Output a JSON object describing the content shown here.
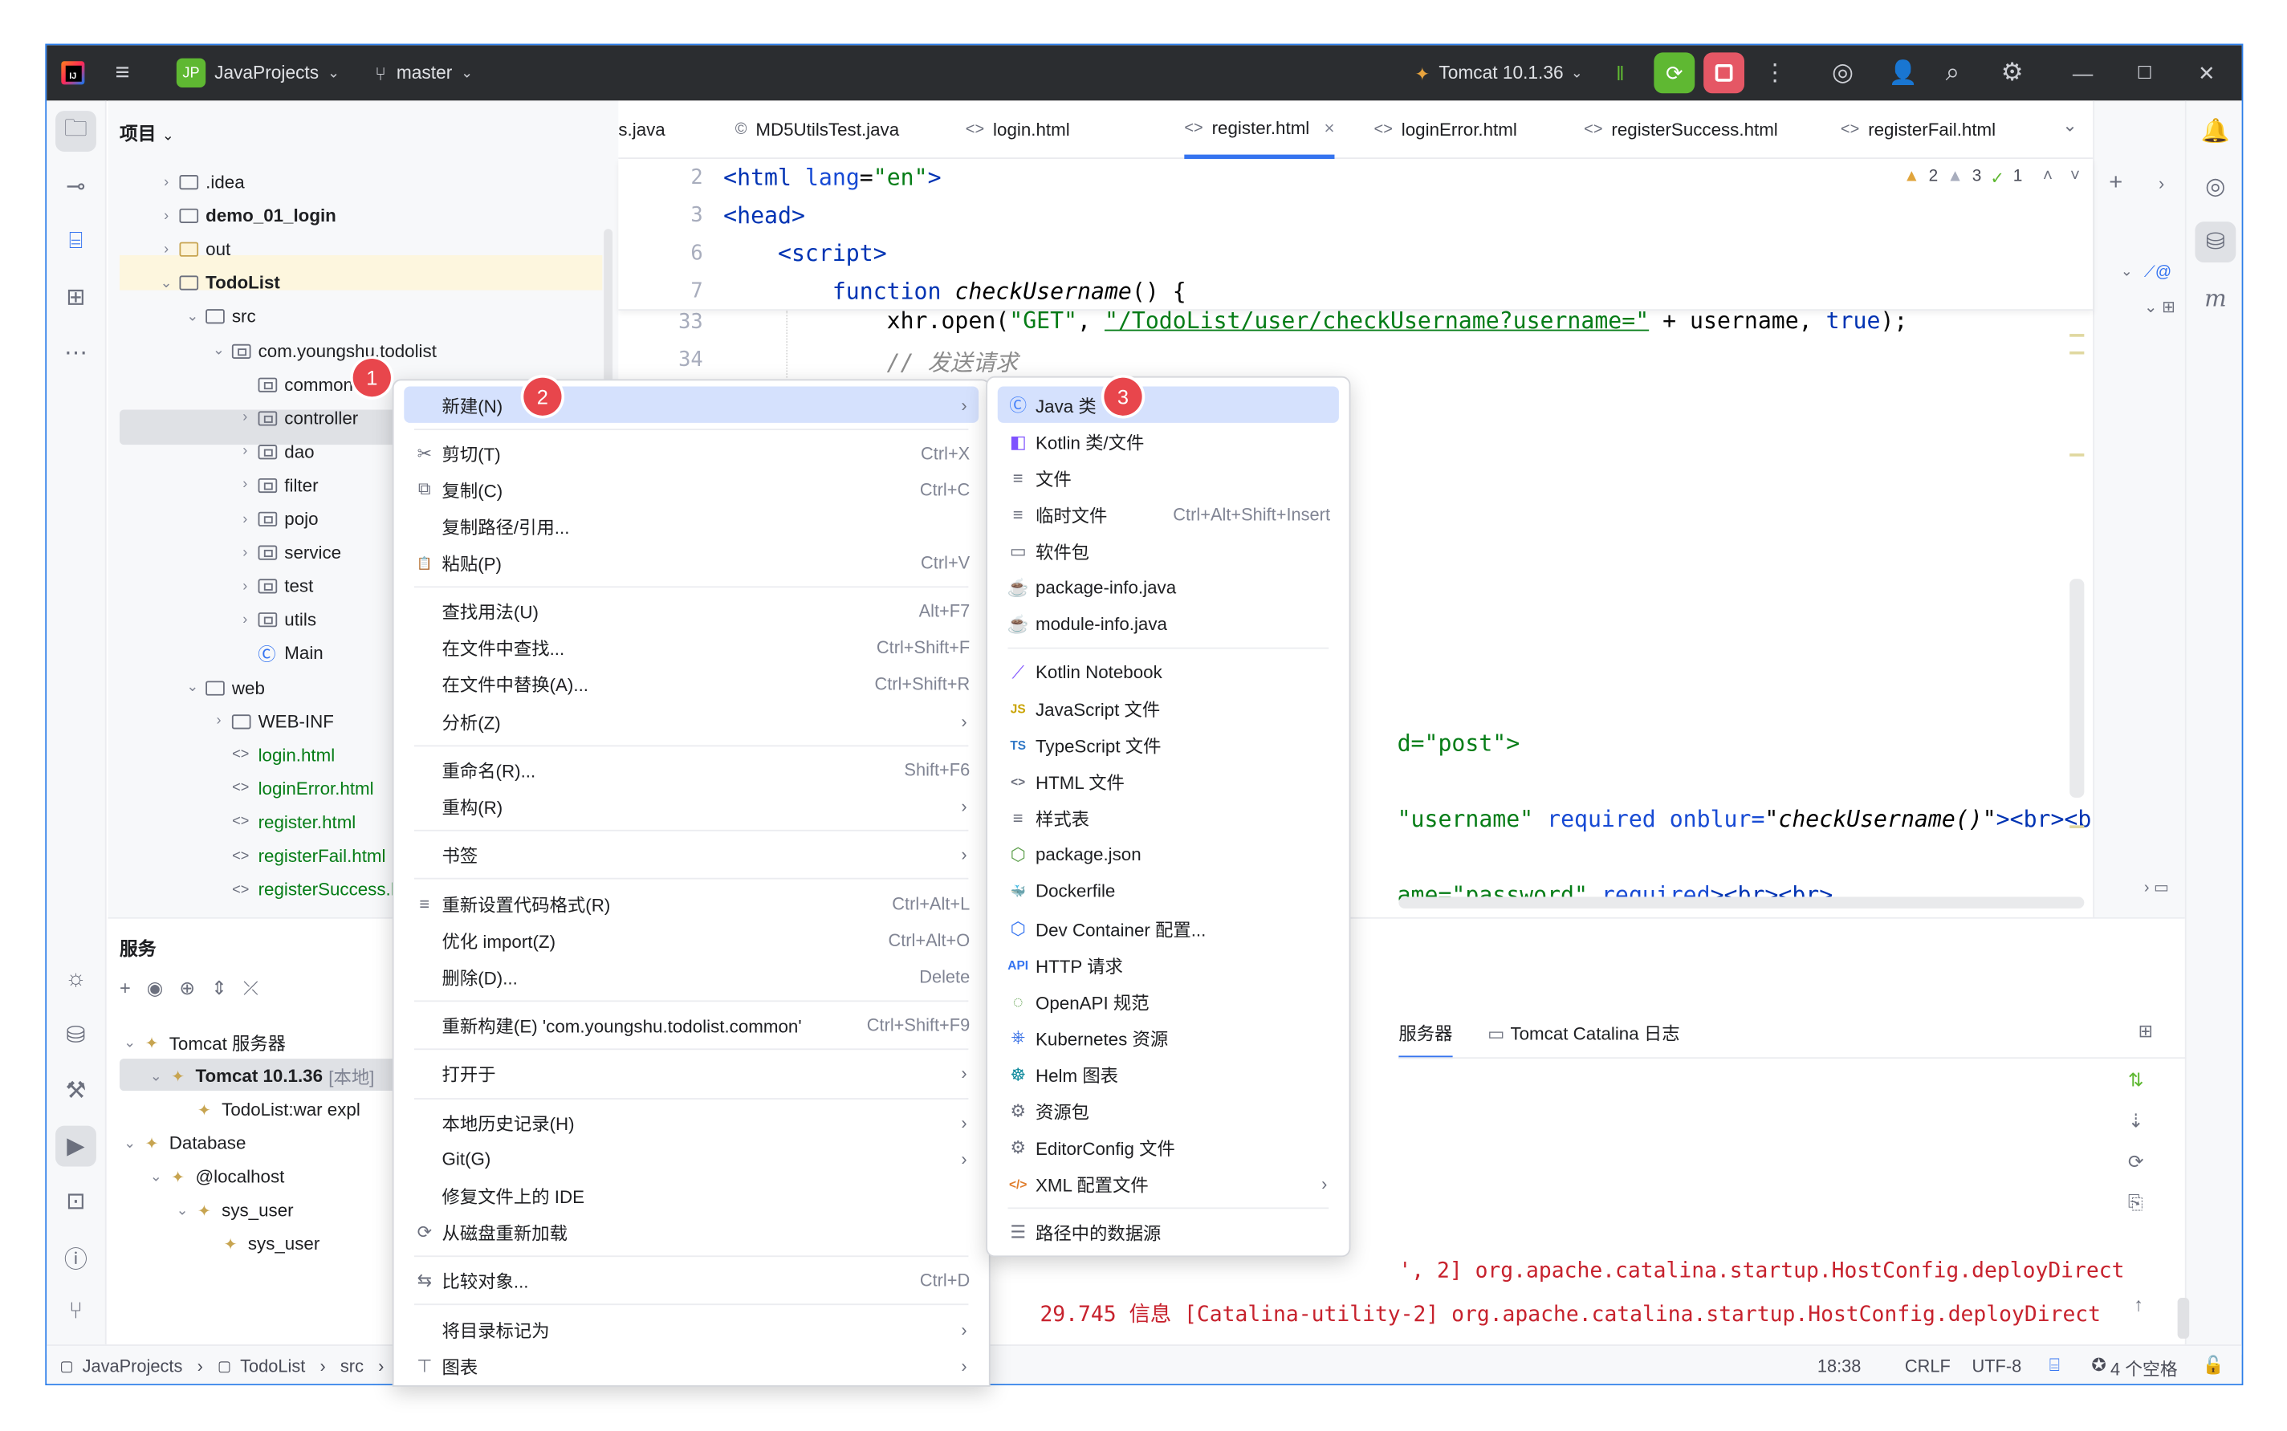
{
  "titlebar": {
    "logo": "IJ",
    "menu_icon": "hamburger-icon",
    "project_badge": "JP",
    "project_name": "JavaProjects",
    "branch": "master",
    "run_config": "Tomcat 10.1.36"
  },
  "project_panel": {
    "title": "项目",
    "tree": [
      {
        "label": ".idea",
        "depth": 1,
        "arrow": "›",
        "icon": "folder",
        "bold": false,
        "color": "normal"
      },
      {
        "label": "demo_01_login",
        "depth": 1,
        "arrow": "›",
        "icon": "module",
        "bold": true,
        "color": "normal"
      },
      {
        "label": "out",
        "depth": 1,
        "arrow": "›",
        "icon": "folder-orange",
        "bold": false,
        "color": "normal"
      },
      {
        "label": "TodoList",
        "depth": 1,
        "arrow": "⌄",
        "icon": "module",
        "bold": true,
        "color": "normal"
      },
      {
        "label": "src",
        "depth": 2,
        "arrow": "⌄",
        "icon": "folder",
        "bold": false,
        "color": "normal"
      },
      {
        "label": "com.youngshu.todolist",
        "depth": 3,
        "arrow": "⌄",
        "icon": "package",
        "bold": false,
        "color": "normal"
      },
      {
        "label": "common",
        "depth": 4,
        "arrow": "",
        "icon": "package",
        "bold": false,
        "color": "normal"
      },
      {
        "label": "controller",
        "depth": 4,
        "arrow": "›",
        "icon": "package",
        "bold": false,
        "color": "normal"
      },
      {
        "label": "dao",
        "depth": 4,
        "arrow": "›",
        "icon": "package",
        "bold": false,
        "color": "normal"
      },
      {
        "label": "filter",
        "depth": 4,
        "arrow": "›",
        "icon": "package",
        "bold": false,
        "color": "normal"
      },
      {
        "label": "pojo",
        "depth": 4,
        "arrow": "›",
        "icon": "package",
        "bold": false,
        "color": "normal"
      },
      {
        "label": "service",
        "depth": 4,
        "arrow": "›",
        "icon": "package",
        "bold": false,
        "color": "normal"
      },
      {
        "label": "test",
        "depth": 4,
        "arrow": "›",
        "icon": "package",
        "bold": false,
        "color": "normal"
      },
      {
        "label": "utils",
        "depth": 4,
        "arrow": "›",
        "icon": "package",
        "bold": false,
        "color": "normal"
      },
      {
        "label": "Main",
        "depth": 4,
        "arrow": "",
        "icon": "class",
        "bold": false,
        "color": "normal"
      },
      {
        "label": "web",
        "depth": 2,
        "arrow": "⌄",
        "icon": "folder",
        "bold": false,
        "color": "normal"
      },
      {
        "label": "WEB-INF",
        "depth": 3,
        "arrow": "›",
        "icon": "folder",
        "bold": false,
        "color": "normal"
      },
      {
        "label": "login.html",
        "depth": 3,
        "arrow": "",
        "icon": "html",
        "bold": false,
        "color": "green"
      },
      {
        "label": "loginError.html",
        "depth": 3,
        "arrow": "",
        "icon": "html",
        "bold": false,
        "color": "green"
      },
      {
        "label": "register.html",
        "depth": 3,
        "arrow": "",
        "icon": "html",
        "bold": false,
        "color": "green"
      },
      {
        "label": "registerFail.html",
        "depth": 3,
        "arrow": "",
        "icon": "html",
        "bold": false,
        "color": "green"
      },
      {
        "label": "registerSuccess.h",
        "depth": 3,
        "arrow": "",
        "icon": "html",
        "bold": false,
        "color": "green"
      }
    ]
  },
  "editor": {
    "tabs": [
      {
        "label": "s.java",
        "icon": "",
        "active": false
      },
      {
        "label": "MD5UtilsTest.java",
        "icon": "©",
        "active": false
      },
      {
        "label": "login.html",
        "icon": "<>",
        "active": false
      },
      {
        "label": "register.html",
        "icon": "<>",
        "active": true
      },
      {
        "label": "loginError.html",
        "icon": "<>",
        "active": false
      },
      {
        "label": "registerSuccess.html",
        "icon": "<>",
        "active": false
      },
      {
        "label": "registerFail.html",
        "icon": "<>",
        "active": false
      }
    ],
    "inspections": {
      "warnings": "2",
      "weak_warnings": "3",
      "ok": "1"
    },
    "line_numbers": [
      "2",
      "3",
      "6",
      "7",
      "33",
      "34"
    ],
    "code_fragments": {
      "l_post": "d=\"post\">",
      "l_user_a": "\"username\"",
      "l_user_b": " required ",
      "l_user_c": "onblur=",
      "l_user_d": "\"checkUsername()\"",
      "l_user_e": "><br><br>",
      "l_pass_a": "ame=\"password\"",
      "l_pass_b": " required",
      "l_pass_c": "><br><br>"
    }
  },
  "services": {
    "title": "服务",
    "tree": [
      {
        "label": "Tomcat 服务器",
        "depth": 0,
        "arrow": "⌄",
        "bold": false
      },
      {
        "label": "Tomcat 10.1.36",
        "suffix": "[本地]",
        "depth": 1,
        "arrow": "⌄",
        "bold": true
      },
      {
        "label": "TodoList:war expl",
        "depth": 2,
        "arrow": "",
        "bold": false
      },
      {
        "label": "Database",
        "depth": 0,
        "arrow": "⌄",
        "bold": false
      },
      {
        "label": "@localhost",
        "depth": 1,
        "arrow": "⌄",
        "bold": false
      },
      {
        "label": "sys_user",
        "depth": 2,
        "arrow": "⌄",
        "bold": false
      },
      {
        "label": "sys_user",
        "depth": 3,
        "arrow": "",
        "bold": false
      }
    ],
    "tabs": [
      "服务器",
      "Tomcat Catalina 日志"
    ],
    "log_line_partial": "', 2] org.apache.catalina.startup.HostConfig.deployDirect",
    "log_line": "29.745 信息 [Catalina-utility-2] org.apache.catalina.startup.HostConfig.deployDirect"
  },
  "statusbar": {
    "breadcrumbs": [
      "JavaProjects",
      "TodoList",
      "src"
    ],
    "position": "18:38",
    "line_ending": "CRLF",
    "encoding": "UTF-8",
    "indent": "4 个空格"
  },
  "context_menu": {
    "items": [
      {
        "label": "新建(N)",
        "shortcut": "",
        "submenu": true,
        "icon": "",
        "selected": true
      },
      {
        "sep": true
      },
      {
        "label": "剪切(T)",
        "shortcut": "Ctrl+X",
        "icon": "✂"
      },
      {
        "label": "复制(C)",
        "shortcut": "Ctrl+C",
        "icon": "⧉"
      },
      {
        "label": "复制路径/引用...",
        "shortcut": "",
        "icon": ""
      },
      {
        "label": "粘贴(P)",
        "shortcut": "Ctrl+V",
        "icon": "📋"
      },
      {
        "sep": true
      },
      {
        "label": "查找用法(U)",
        "shortcut": "Alt+F7",
        "icon": ""
      },
      {
        "label": "在文件中查找...",
        "shortcut": "Ctrl+Shift+F",
        "icon": ""
      },
      {
        "label": "在文件中替换(A)...",
        "shortcut": "Ctrl+Shift+R",
        "icon": ""
      },
      {
        "label": "分析(Z)",
        "shortcut": "",
        "submenu": true,
        "icon": ""
      },
      {
        "sep": true
      },
      {
        "label": "重命名(R)...",
        "shortcut": "Shift+F6",
        "icon": ""
      },
      {
        "label": "重构(R)",
        "shortcut": "",
        "submenu": true,
        "icon": ""
      },
      {
        "sep": true
      },
      {
        "label": "书签",
        "shortcut": "",
        "submenu": true,
        "icon": ""
      },
      {
        "sep": true
      },
      {
        "label": "重新设置代码格式(R)",
        "shortcut": "Ctrl+Alt+L",
        "icon": "≡"
      },
      {
        "label": "优化 import(Z)",
        "shortcut": "Ctrl+Alt+O",
        "icon": ""
      },
      {
        "label": "删除(D)...",
        "shortcut": "Delete",
        "icon": ""
      },
      {
        "sep": true
      },
      {
        "label": "重新构建(E) 'com.youngshu.todolist.common'",
        "shortcut": "Ctrl+Shift+F9",
        "icon": ""
      },
      {
        "sep": true
      },
      {
        "label": "打开于",
        "shortcut": "",
        "submenu": true,
        "icon": ""
      },
      {
        "sep": true
      },
      {
        "label": "本地历史记录(H)",
        "shortcut": "",
        "submenu": true,
        "icon": ""
      },
      {
        "label": "Git(G)",
        "shortcut": "",
        "submenu": true,
        "icon": ""
      },
      {
        "label": "修复文件上的 IDE",
        "shortcut": "",
        "icon": ""
      },
      {
        "label": "从磁盘重新加载",
        "shortcut": "",
        "icon": "⟳"
      },
      {
        "sep": true
      },
      {
        "label": "比较对象...",
        "shortcut": "Ctrl+D",
        "icon": "⇆"
      },
      {
        "sep": true
      },
      {
        "label": "将目录标记为",
        "shortcut": "",
        "submenu": true,
        "icon": ""
      },
      {
        "label": "图表",
        "shortcut": "",
        "submenu": true,
        "icon": "⊤"
      }
    ]
  },
  "new_submenu": {
    "items": [
      {
        "label": "Java 类",
        "icon": "Ⓒ",
        "color": "#4682fa",
        "selected": true
      },
      {
        "label": "Kotlin 类/文件",
        "icon": "◧",
        "color": "#7f52ff"
      },
      {
        "label": "文件",
        "icon": "≡",
        "color": "#6c707e"
      },
      {
        "label": "临时文件",
        "shortcut": "Ctrl+Alt+Shift+Insert",
        "icon": "≡",
        "color": "#6c707e"
      },
      {
        "label": "软件包",
        "icon": "▭",
        "color": "#6c707e"
      },
      {
        "label": "package-info.java",
        "icon": "☕",
        "color": "#e07d2c"
      },
      {
        "label": "module-info.java",
        "icon": "☕",
        "color": "#e07d2c"
      },
      {
        "sep": true
      },
      {
        "label": "Kotlin Notebook",
        "icon": "⟋",
        "color": "#7f52ff"
      },
      {
        "label": "JavaScript 文件",
        "icon": "JS",
        "color": "#c9a300"
      },
      {
        "label": "TypeScript 文件",
        "icon": "TS",
        "color": "#3178c6"
      },
      {
        "label": "HTML 文件",
        "icon": "<>",
        "color": "#6c707e"
      },
      {
        "label": "样式表",
        "icon": "≡",
        "color": "#6c707e"
      },
      {
        "label": "package.json",
        "icon": "⬡",
        "color": "#5fa04e"
      },
      {
        "label": "Dockerfile",
        "icon": "🐳",
        "color": "#2496ed"
      },
      {
        "label": "Dev Container 配置...",
        "icon": "⬡",
        "color": "#3574f0"
      },
      {
        "label": "HTTP 请求",
        "icon": "API",
        "color": "#3574f0"
      },
      {
        "label": "OpenAPI 规范",
        "icon": "◌",
        "color": "#5fa04e"
      },
      {
        "label": "Kubernetes 资源",
        "icon": "⎈",
        "color": "#326ce5"
      },
      {
        "label": "Helm 图表",
        "icon": "☸",
        "color": "#0f8a9d"
      },
      {
        "label": "资源包",
        "icon": "⚙",
        "color": "#6c707e"
      },
      {
        "label": "EditorConfig 文件",
        "icon": "⚙",
        "color": "#6c707e"
      },
      {
        "label": "XML 配置文件",
        "icon": "</>",
        "color": "#e07d2c",
        "submenu": true
      },
      {
        "sep": true
      },
      {
        "label": "路径中的数据源",
        "icon": "☰",
        "color": "#6c707e"
      }
    ]
  },
  "badges": [
    "1",
    "2",
    "3"
  ]
}
